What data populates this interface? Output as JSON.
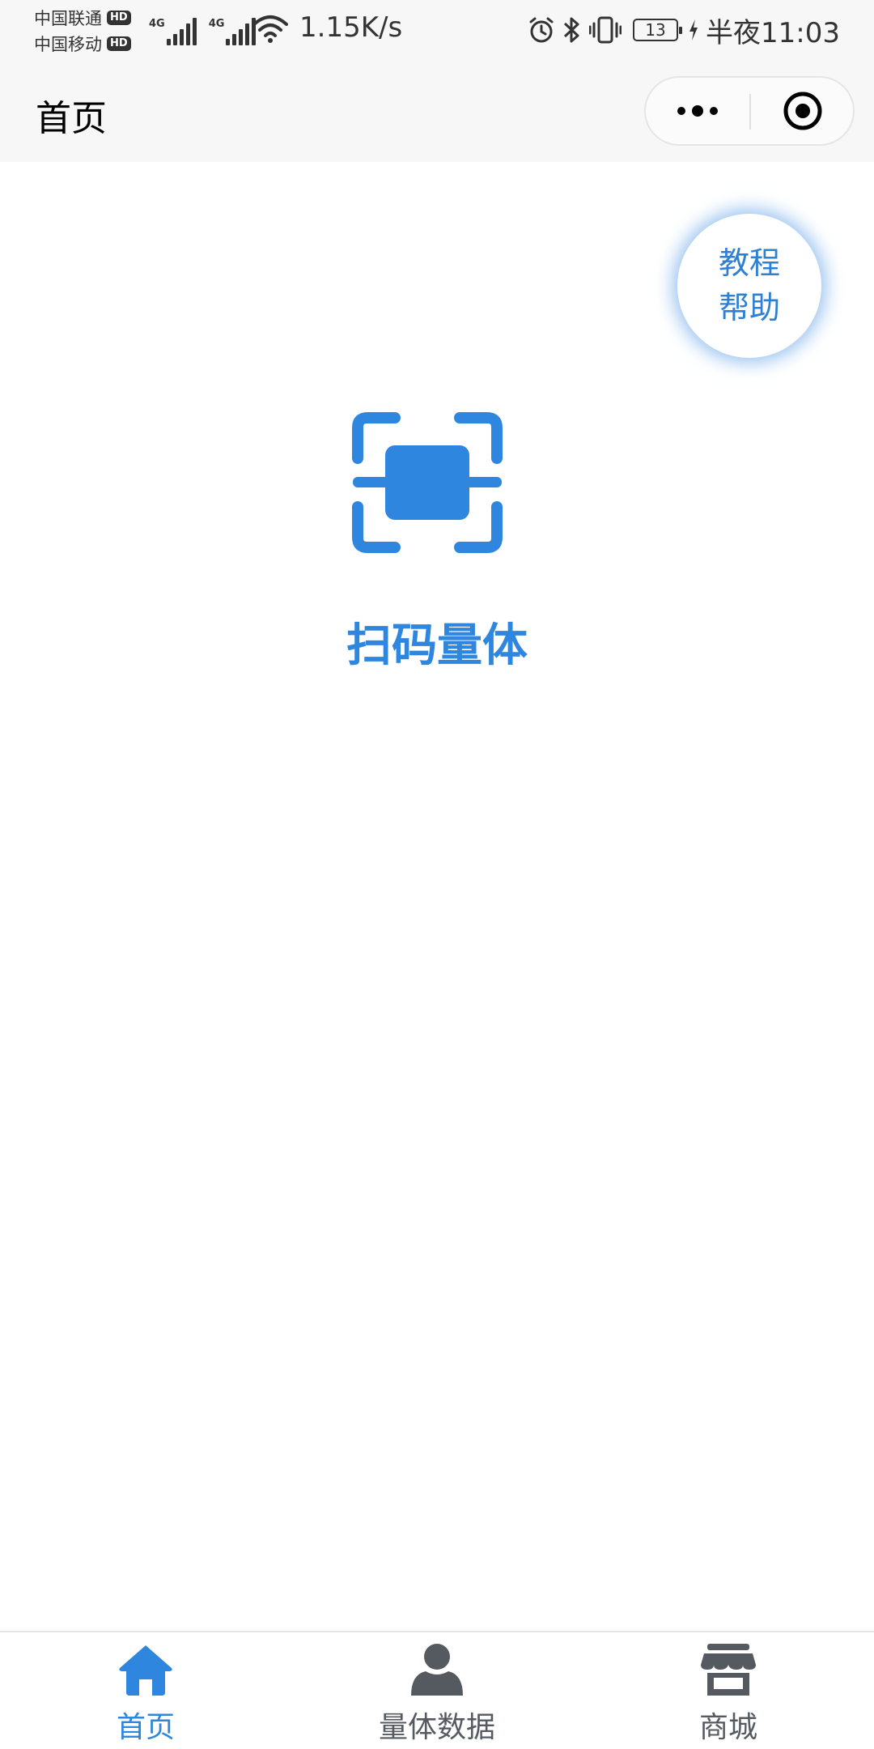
{
  "status_bar": {
    "carrier_1": "中国联通",
    "carrier_2": "中国移动",
    "hd_badge": "HD",
    "network_1": "4G",
    "network_2": "4G",
    "net_speed": "1.15K/s",
    "battery_level": "13",
    "time": "半夜11:03",
    "icons": [
      "signal-icon",
      "wifi-icon",
      "alarm-icon",
      "bluetooth-icon",
      "vibrate-icon",
      "battery-icon",
      "charging-icon"
    ]
  },
  "nav_bar": {
    "title": "首页",
    "icons": [
      "more-dots-icon",
      "close-target-icon"
    ]
  },
  "main": {
    "help_line_1": "教程",
    "help_line_2": "帮助",
    "scan_label": "扫码量体",
    "scan_icon": "scan-icon"
  },
  "tab_bar": {
    "tabs": [
      {
        "label": "首页",
        "icon": "home-icon",
        "active": true
      },
      {
        "label": "量体数据",
        "icon": "user-icon",
        "active": false
      },
      {
        "label": "商城",
        "icon": "store-icon",
        "active": false
      }
    ]
  },
  "colors": {
    "accent": "#2f86de",
    "help_text": "#2f7fd3",
    "tab_inactive": "#555a61",
    "bar_background": "#f7f7f7"
  }
}
